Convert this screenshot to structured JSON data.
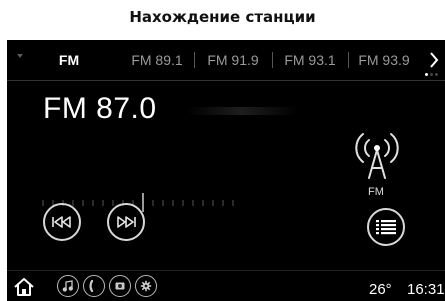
{
  "page_title": "Нахождение станции",
  "tabs": [
    {
      "label": "FM",
      "active": true
    },
    {
      "label": "FM 89.1",
      "active": false
    },
    {
      "label": "FM 91.9",
      "active": false
    },
    {
      "label": "FM 93.1",
      "active": false
    },
    {
      "label": "FM 93.9",
      "active": false
    }
  ],
  "station": {
    "frequency": "FM 87.0",
    "band_label": "FM"
  },
  "status": {
    "temperature": "26°",
    "time": "16:31"
  },
  "icons": {
    "tab_left": "chevron-down-icon",
    "tab_right": "chevron-right-icon",
    "antenna": "radio-antenna-icon",
    "prev": "seek-previous-icon",
    "next": "seek-next-icon",
    "list": "list-icon",
    "home": "home-icon",
    "music": "music-note-icon",
    "phone": "phone-icon",
    "camera": "camera-icon",
    "settings": "gear-icon"
  },
  "colors": {
    "screen_background": "#000000",
    "text_primary": "#ffffff",
    "text_inactive": "#9a9a9a"
  }
}
